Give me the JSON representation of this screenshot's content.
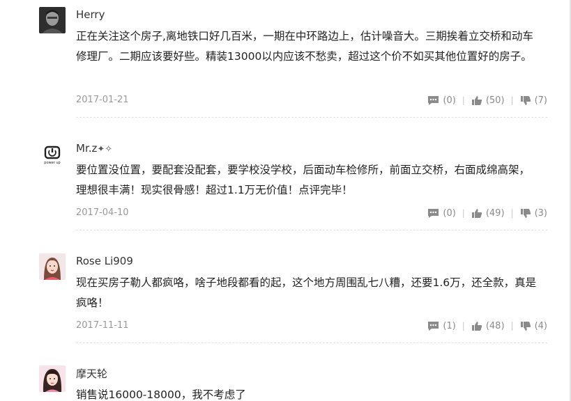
{
  "comments": [
    {
      "username": "Herry",
      "text": "正在关注这个房子,离地铁口好几百米，一期在中环路边上，估计噪音大。三期挨着立交桥和动车修理厂。二期应该要好些。精装13000以内应该不愁卖，超过这个价不如买其他位置好的房子。",
      "date": "2017-01-21",
      "reply_count": "(0)",
      "like_count": "(50)",
      "dislike_count": "(7)"
    },
    {
      "username": "Mr.z",
      "username_suffix": "✦✧",
      "avatar_label": "power up",
      "text": "要位置没位置，要配套没配套，要学校没学校，后面动车检修所，前面立交桥，右面成绵高架，理想很丰满！现实很骨感！超过1.1万无价值！点评完毕！",
      "date": "2017-04-10",
      "reply_count": "(0)",
      "like_count": "(49)",
      "dislike_count": "(3)"
    },
    {
      "username": "Rose Li909",
      "text": "现在买房子勒人都疯咯，啥子地段都看的起，这个地方周围乱七八糟，还要1.6万，还全款，真是疯咯！",
      "date": "2017-11-11",
      "reply_count": "(1)",
      "like_count": "(48)",
      "dislike_count": "(4)"
    },
    {
      "username": "摩天轮",
      "text": "销售说16000-18000，我不考虑了"
    }
  ],
  "colors": {
    "username": "#333333",
    "text": "#222222",
    "meta": "#999999",
    "icon": "#8a8a8a",
    "divider": "#e2e2e2"
  },
  "icons": {
    "reply": "comment-bubble-icon",
    "like": "thumbs-up-icon",
    "dislike": "thumbs-down-icon"
  }
}
